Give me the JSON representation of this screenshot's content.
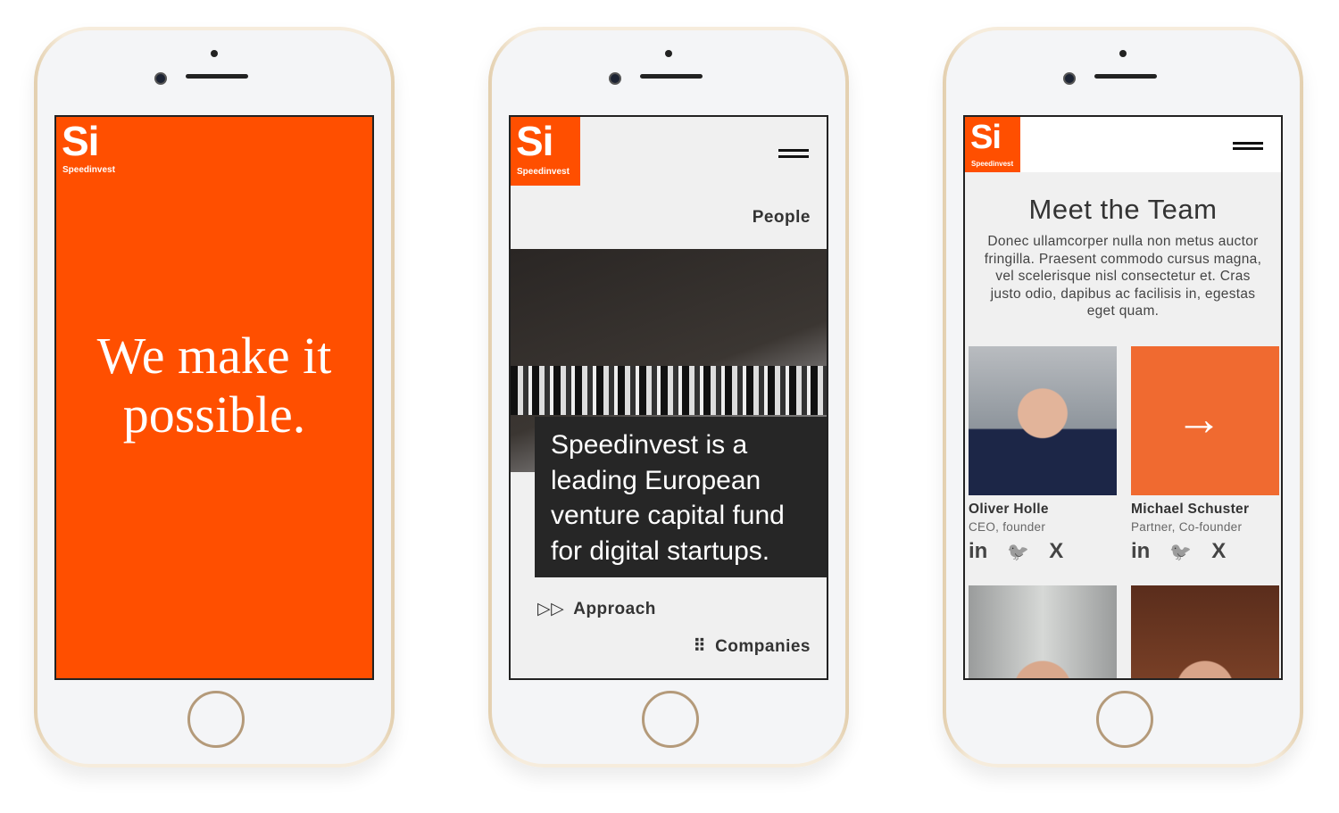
{
  "brand": {
    "logo_text": "Si",
    "name": "Speedinvest",
    "accent": "#ff4f00"
  },
  "screen1": {
    "headline_line1": "We make it",
    "headline_line2": "possible."
  },
  "screen2": {
    "nav_current": "People",
    "intro": "Speedinvest is a leading European venture capital fund for digital startups.",
    "links": [
      {
        "label": "Approach",
        "icon": "double-play-icon"
      },
      {
        "label": "Companies",
        "icon": "grid-dots-icon"
      }
    ]
  },
  "screen3": {
    "title": "Meet the Team",
    "description": "Donec ullamcorper nulla non metus auctor fringilla. Praesent commodo cursus magna, vel scelerisque nisl consectetur et. Cras justo odio, dapibus ac facilisis in, egestas eget quam.",
    "members": [
      {
        "name": "Oliver Holle",
        "role": "CEO, founder"
      },
      {
        "name": "Michael Schuster",
        "role": "Partner, Co-founder"
      }
    ],
    "social": {
      "linkedin": "in",
      "twitter": "🐦",
      "xing": "X"
    }
  }
}
